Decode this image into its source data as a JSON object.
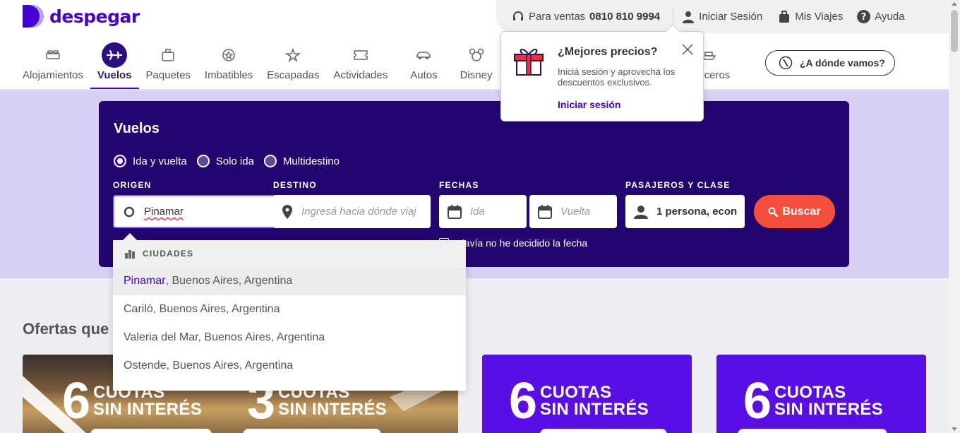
{
  "logo": {
    "text": "despegar"
  },
  "topbar": {
    "sales_prefix": "Para ventas",
    "sales_phone": "0810 810 9994",
    "login": "Iniciar Sesión",
    "trips": "Mis Viajes",
    "help": "Ayuda"
  },
  "nav": {
    "items": [
      {
        "label": "Alojamientos"
      },
      {
        "label": "Vuelos",
        "active": true
      },
      {
        "label": "Paquetes"
      },
      {
        "label": "Imbatibles"
      },
      {
        "label": "Escapadas"
      },
      {
        "label": "Actividades"
      },
      {
        "label": "Autos"
      },
      {
        "label": "Disney"
      },
      {
        "label": "Cruceros"
      }
    ],
    "where_button": "¿A dónde vamos?"
  },
  "popover": {
    "title": "¿Mejores precios?",
    "body": "Iniciá sesión y aprovechá los descuentos exclusivos.",
    "link": "Iniciar sesión"
  },
  "search": {
    "title": "Vuelos",
    "trip_types": [
      "Ida y vuelta",
      "Solo ida",
      "Multidestino"
    ],
    "selected_trip_type": "Ida y vuelta",
    "origin_label": "ORIGEN",
    "origin_value": "Pinamar",
    "destination_label": "DESTINO",
    "destination_placeholder": "Ingresá hacia dónde viaj",
    "dates_label": "FECHAS",
    "depart_placeholder": "Ida",
    "return_placeholder": "Vuelta",
    "pax_label": "PASAJEROS Y CLASE",
    "pax_value": "1 persona, econ",
    "search_button": "Buscar",
    "no_date": "Todavía no he decidido la fecha",
    "no_date_visible": "davía no he decidido la fecha"
  },
  "dropdown": {
    "header": "CIUDADES",
    "items": [
      {
        "match": "Pinamar",
        "rest": ", Buenos Aires, Argentina"
      },
      {
        "match": "",
        "rest": "Cariló, Buenos Aires, Argentina"
      },
      {
        "match": "",
        "rest": "Valeria del Mar, Buenos Aires, Argentina"
      },
      {
        "match": "",
        "rest": "Ostende, Buenos Aires, Argentina"
      }
    ]
  },
  "offers": {
    "title": "Ofertas que",
    "promos": [
      {
        "number": "6",
        "line1": "CUOTAS",
        "line2": "SIN INTERÉS"
      },
      {
        "number": "3",
        "line1": "CUOTAS",
        "line2": "SIN INTERÉS"
      },
      {
        "number": "6",
        "line1": "CUOTAS",
        "line2": "SIN INTERÉS"
      },
      {
        "number": "6",
        "line1": "CUOTAS",
        "line2": "SIN INTERÉS"
      }
    ]
  },
  "colors": {
    "brand": "#4300d2",
    "search_bg": "#240570",
    "band": "#d8cff5",
    "cta": "#f44f3c"
  }
}
